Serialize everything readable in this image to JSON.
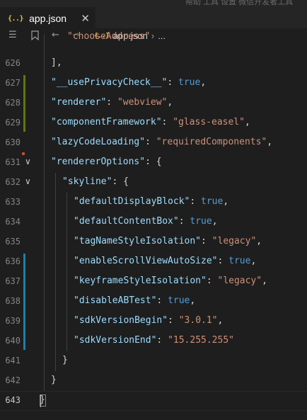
{
  "top_strip": {
    "faint_text": "帮助  工具  设置  微信开发者工具"
  },
  "tab": {
    "icon_text": "{..}",
    "name": "app.json",
    "close_glyph": "✕"
  },
  "breadcrumb": {
    "icon_text": "{..}",
    "file": "app.json",
    "separator": "›",
    "ellipsis": "..."
  },
  "toolbar_icons": {
    "list": "☰",
    "bookmark": "⌂",
    "back": "←",
    "forward": "→"
  },
  "colors": {
    "key": "#9cdcfe",
    "string": "#ce9178",
    "boolean": "#569cd6",
    "added_bar": "#587c0c",
    "modified_bar": "#1b81a8"
  },
  "lines": [
    {
      "num": "",
      "tokens": [
        {
          "t": "\"chooseAddress\"",
          "c": "s"
        }
      ]
    },
    {
      "num": "626",
      "tokens": [
        {
          "t": "],",
          "c": "p"
        }
      ]
    },
    {
      "num": "627",
      "tokens": [
        {
          "t": "\"__usePrivacyCheck__\"",
          "c": "k"
        },
        {
          "t": ": ",
          "c": "p"
        },
        {
          "t": "true",
          "c": "b"
        },
        {
          "t": ",",
          "c": "p"
        }
      ]
    },
    {
      "num": "628",
      "tokens": [
        {
          "t": "\"renderer\"",
          "c": "k"
        },
        {
          "t": ": ",
          "c": "p"
        },
        {
          "t": "\"webview\"",
          "c": "s"
        },
        {
          "t": ",",
          "c": "p"
        }
      ]
    },
    {
      "num": "629",
      "tokens": [
        {
          "t": "\"componentFramework\"",
          "c": "k"
        },
        {
          "t": ": ",
          "c": "p"
        },
        {
          "t": "\"glass-easel\"",
          "c": "s"
        },
        {
          "t": ",",
          "c": "p"
        }
      ]
    },
    {
      "num": "630",
      "tokens": [
        {
          "t": "\"lazyCodeLoading\"",
          "c": "k"
        },
        {
          "t": ": ",
          "c": "p"
        },
        {
          "t": "\"requiredComponents\"",
          "c": "s"
        },
        {
          "t": ",",
          "c": "p"
        }
      ]
    },
    {
      "num": "631",
      "tokens": [
        {
          "t": "\"rendererOptions\"",
          "c": "k"
        },
        {
          "t": ": {",
          "c": "p"
        }
      ]
    },
    {
      "num": "632",
      "tokens": [
        {
          "t": "\"skyline\"",
          "c": "k"
        },
        {
          "t": ": {",
          "c": "p"
        }
      ]
    },
    {
      "num": "633",
      "tokens": [
        {
          "t": "\"defaultDisplayBlock\"",
          "c": "k"
        },
        {
          "t": ": ",
          "c": "p"
        },
        {
          "t": "true",
          "c": "b"
        },
        {
          "t": ",",
          "c": "p"
        }
      ]
    },
    {
      "num": "634",
      "tokens": [
        {
          "t": "\"defaultContentBox\"",
          "c": "k"
        },
        {
          "t": ": ",
          "c": "p"
        },
        {
          "t": "true",
          "c": "b"
        },
        {
          "t": ",",
          "c": "p"
        }
      ]
    },
    {
      "num": "635",
      "tokens": [
        {
          "t": "\"tagNameStyleIsolation\"",
          "c": "k"
        },
        {
          "t": ": ",
          "c": "p"
        },
        {
          "t": "\"legacy\"",
          "c": "s"
        },
        {
          "t": ",",
          "c": "p"
        }
      ]
    },
    {
      "num": "636",
      "tokens": [
        {
          "t": "\"enableScrollViewAutoSize\"",
          "c": "k"
        },
        {
          "t": ": ",
          "c": "p"
        },
        {
          "t": "true",
          "c": "b"
        },
        {
          "t": ",",
          "c": "p"
        }
      ]
    },
    {
      "num": "637",
      "tokens": [
        {
          "t": "\"keyframeStyleIsolation\"",
          "c": "k"
        },
        {
          "t": ": ",
          "c": "p"
        },
        {
          "t": "\"legacy\"",
          "c": "s"
        },
        {
          "t": ",",
          "c": "p"
        }
      ]
    },
    {
      "num": "638",
      "tokens": [
        {
          "t": "\"disableABTest\"",
          "c": "k"
        },
        {
          "t": ": ",
          "c": "p"
        },
        {
          "t": "true",
          "c": "b"
        },
        {
          "t": ",",
          "c": "p"
        }
      ]
    },
    {
      "num": "639",
      "tokens": [
        {
          "t": "\"sdkVersionBegin\"",
          "c": "k"
        },
        {
          "t": ": ",
          "c": "p"
        },
        {
          "t": "\"3.0.1\"",
          "c": "s"
        },
        {
          "t": ",",
          "c": "p"
        }
      ]
    },
    {
      "num": "640",
      "tokens": [
        {
          "t": "\"sdkVersionEnd\"",
          "c": "k"
        },
        {
          "t": ": ",
          "c": "p"
        },
        {
          "t": "\"15.255.255\"",
          "c": "s"
        }
      ]
    },
    {
      "num": "641",
      "tokens": [
        {
          "t": "}",
          "c": "p"
        }
      ]
    },
    {
      "num": "642",
      "tokens": [
        {
          "t": "}",
          "c": "p"
        }
      ]
    },
    {
      "num": "643",
      "tokens": [
        {
          "t": "}",
          "c": "p"
        }
      ]
    }
  ],
  "fold_glyph": "∨"
}
